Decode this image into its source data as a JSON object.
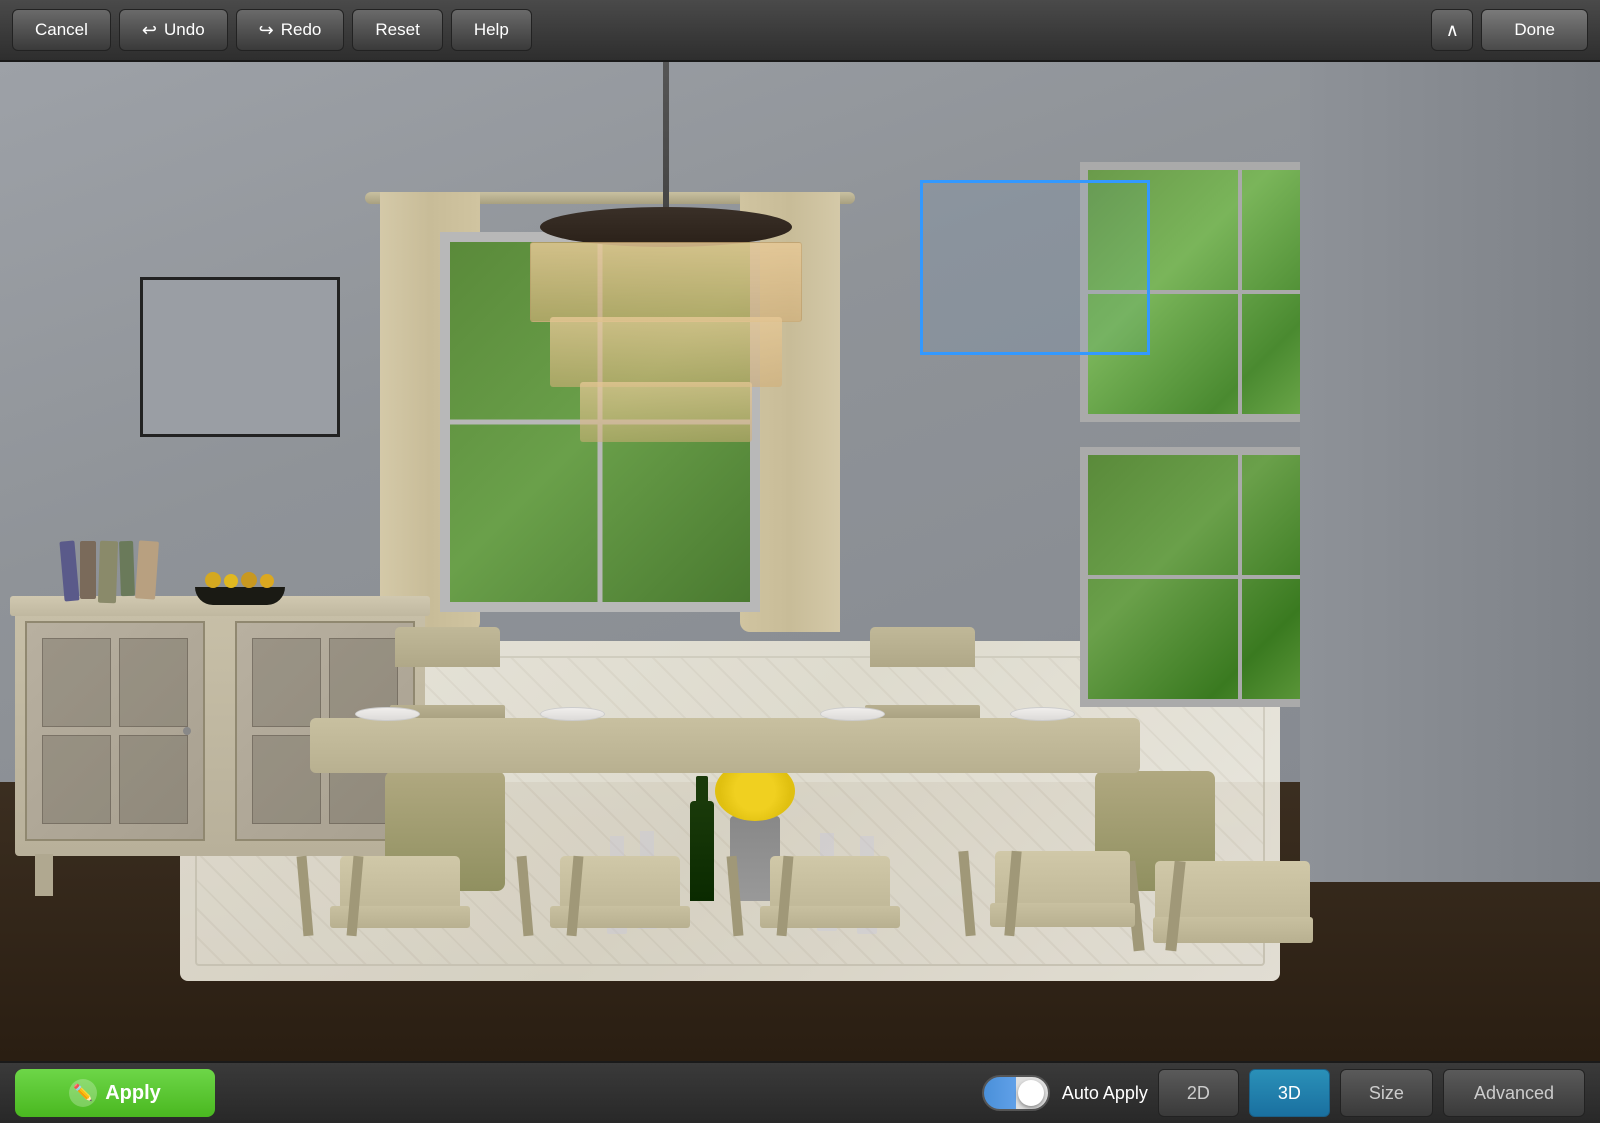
{
  "toolbar": {
    "cancel_label": "Cancel",
    "undo_label": "Undo",
    "redo_label": "Redo",
    "reset_label": "Reset",
    "help_label": "Help",
    "done_label": "Done"
  },
  "bottom_toolbar": {
    "apply_label": "Apply",
    "auto_apply_label": "Auto Apply",
    "mode_2d_label": "2D",
    "mode_3d_label": "3D",
    "size_label": "Size",
    "advanced_label": "Advanced"
  },
  "scene": {
    "description": "3D dining room visualization"
  },
  "icons": {
    "undo": "↩",
    "redo": "↪",
    "collapse": "∧",
    "paint": "🖌"
  }
}
